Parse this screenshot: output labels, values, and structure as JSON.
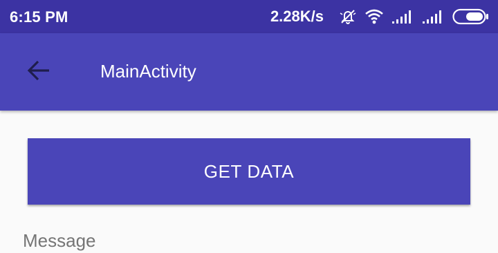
{
  "status_bar": {
    "time": "6:15 PM",
    "network_speed": "2.28K/s",
    "icons": [
      "bell-off-icon",
      "wifi-icon",
      "signal-icon",
      "signal-icon",
      "battery-icon"
    ]
  },
  "app_bar": {
    "title": "MainActivity",
    "back_icon": "arrow-back-icon"
  },
  "main": {
    "get_data_label": "GET DATA",
    "message_label": "Message"
  },
  "colors": {
    "status_bar": "#3c33a3",
    "primary": "#4a45b8",
    "background": "#fafafa",
    "label_text": "#757575"
  }
}
